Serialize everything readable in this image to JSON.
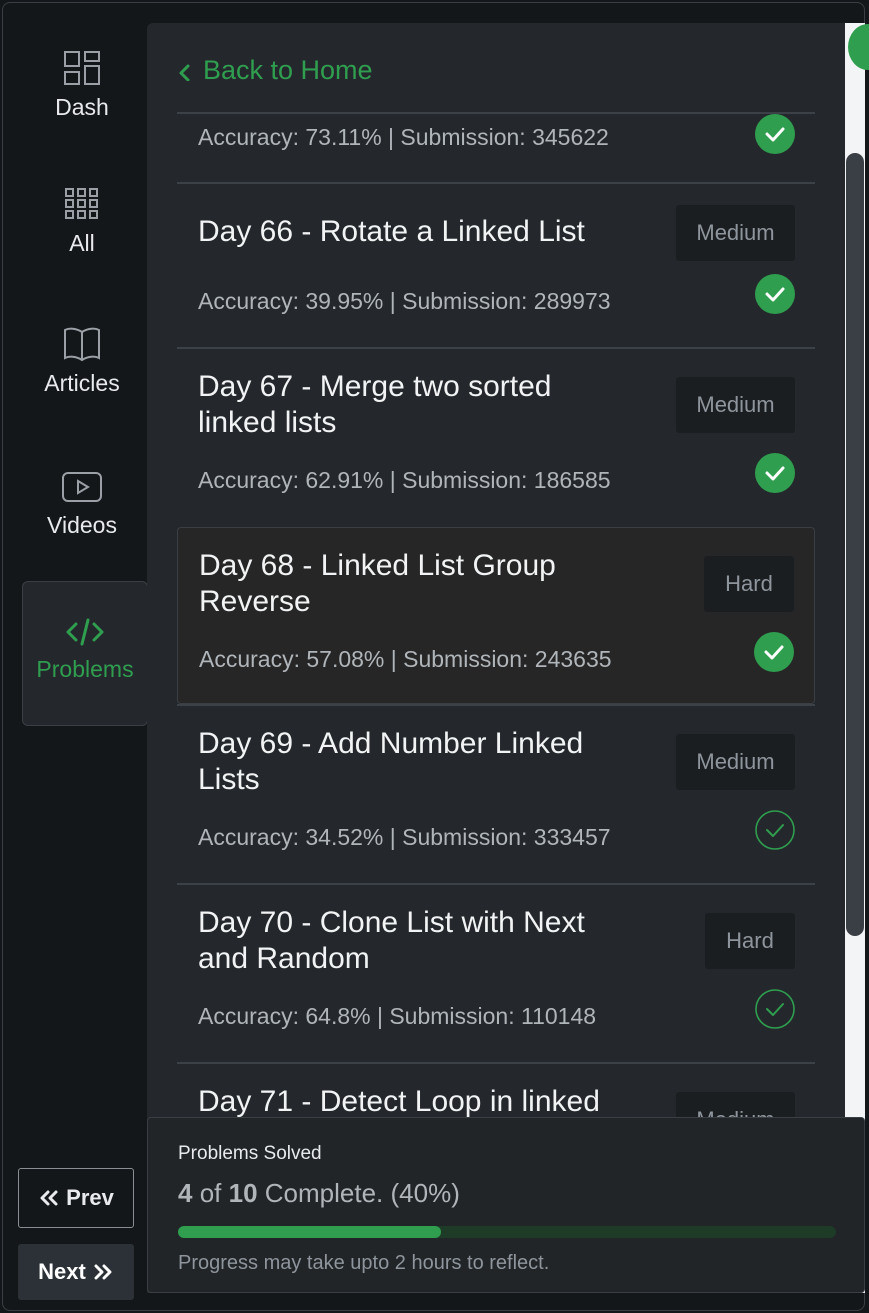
{
  "nav": {
    "dash": "Dash",
    "all": "All",
    "articles": "Articles",
    "videos": "Videos",
    "problems": "Problems"
  },
  "buttons": {
    "prev": "Prev",
    "next": "Next"
  },
  "back_link": "Back to Home",
  "partial_top_meta": "Accuracy: 73.11% | Submission: 345622",
  "problems": [
    {
      "title": "Day 66 - Rotate a Linked List",
      "meta": "Accuracy: 39.95% | Submission: 289973",
      "difficulty": "Medium",
      "status": "solved"
    },
    {
      "title": "Day 67 - Merge two sorted linked lists",
      "meta": "Accuracy: 62.91% | Submission: 186585",
      "difficulty": "Medium",
      "status": "solved"
    },
    {
      "title": "Day 68 - Linked List Group Reverse",
      "meta": "Accuracy: 57.08% | Submission: 243635",
      "difficulty": "Hard",
      "status": "solved"
    },
    {
      "title": "Day 69 - Add Number Linked Lists",
      "meta": "Accuracy: 34.52% | Submission: 333457",
      "difficulty": "Medium",
      "status": "unsolved"
    },
    {
      "title": "Day 70 - Clone List with Next and Random",
      "meta": "Accuracy: 64.8% | Submission: 110148",
      "difficulty": "Hard",
      "status": "unsolved"
    },
    {
      "title": "Day 71 - Detect Loop in linked",
      "difficulty": "Medium"
    }
  ],
  "progress": {
    "label": "Problems Solved",
    "solved": "4",
    "of": "of",
    "total": "10",
    "complete_text": "Complete. (40%)",
    "fraction": 0.4,
    "note": "Progress may take upto 2 hours to reflect."
  },
  "colors": {
    "accent": "#2f9e4f",
    "panel_bg": "#24282c",
    "badge_bg": "#1b1e21"
  }
}
